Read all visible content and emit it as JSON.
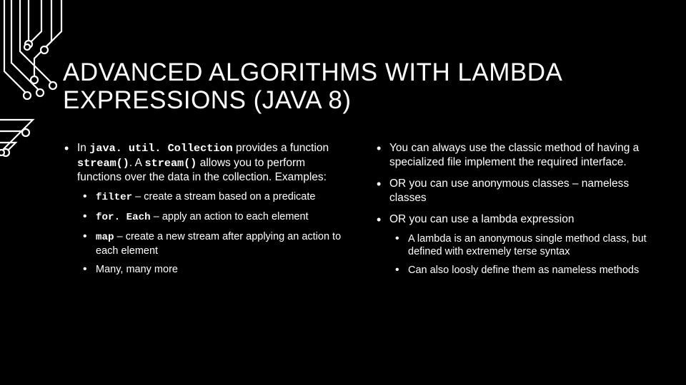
{
  "title": "ADVANCED ALGORITHMS WITH LAMBDA EXPRESSIONS (JAVA 8)",
  "left": {
    "intro": {
      "t1": "In ",
      "c1": "java. util. Collection",
      "t2": " provides a function ",
      "c2": "stream()",
      "t3": ". A ",
      "c3": "stream()",
      "t4": " allows you to perform functions over the data in the collection. Examples:"
    },
    "subs": {
      "s1c": "filter",
      "s1t": " – create a stream based on a predicate",
      "s2c": "for. Each",
      "s2t": " – apply an action to each element",
      "s3c": "map",
      "s3t": " – create a new stream after applying an action to each element",
      "s4": "Many, many more"
    }
  },
  "right": {
    "b1": "You can always use the classic method of having a specialized file implement the required interface.",
    "b2": "OR you can use anonymous classes – nameless classes",
    "b3": "OR you can use a lambda expression",
    "subs": {
      "s1": "A lambda is an anonymous single method class, but defined with extremely terse syntax",
      "s2": "Can also loosly define them as nameless methods"
    }
  }
}
